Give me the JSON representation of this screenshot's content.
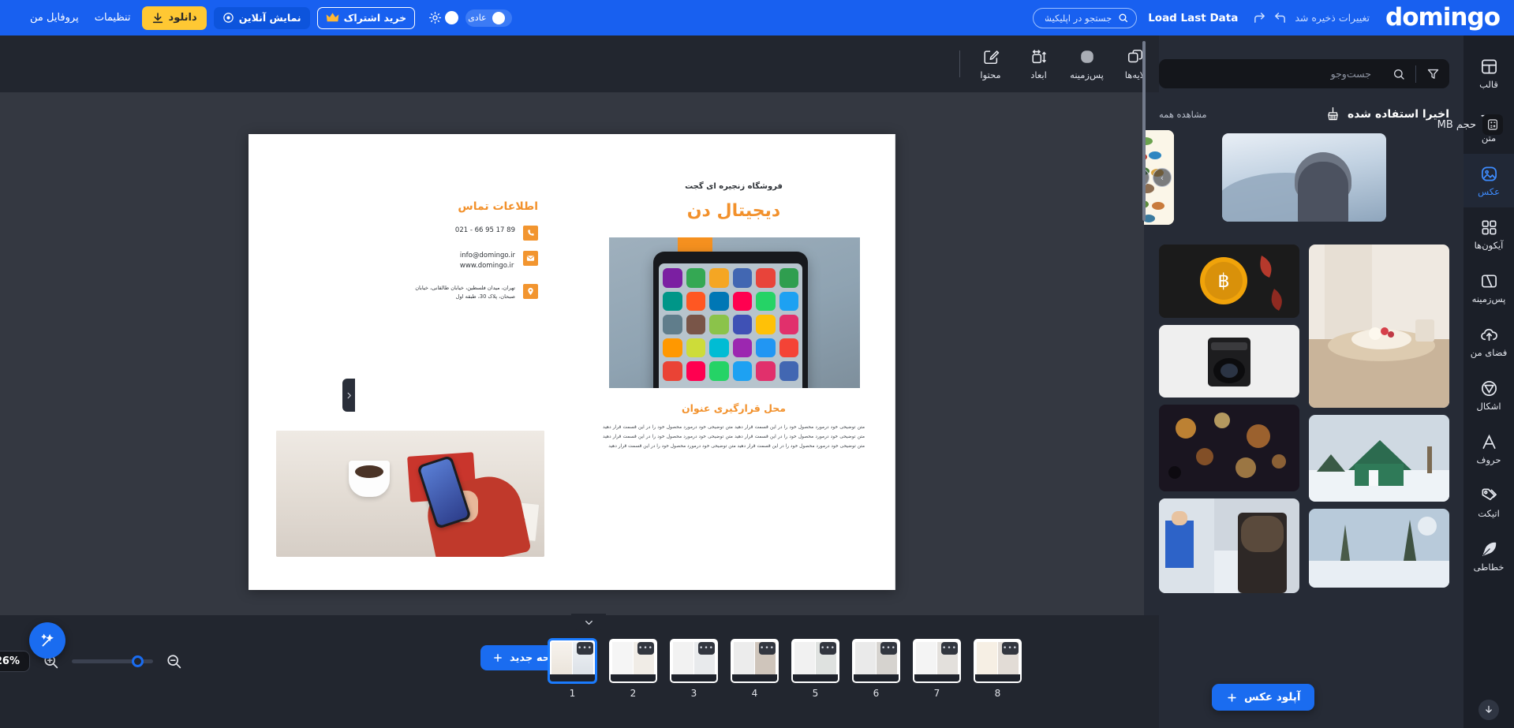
{
  "topbar": {
    "logo": "domingo",
    "saved_text": "تغییرات ذخیره شد",
    "undo_icon": "undo-icon",
    "redo_icon": "redo-icon",
    "load_last_data": "Load Last Data",
    "search_placeholder": "جستجو در اپلیکیشن...",
    "search_value": "",
    "mode_toggle_label": "عادی",
    "theme_icon": "sun-icon",
    "buy_subscription": "خرید اشتراک",
    "crown_icon": "crown-icon",
    "online_preview": "نمایش آنلاین",
    "eye_icon": "eye-icon",
    "download": "دانلود",
    "download_icon": "download-icon",
    "settings": "تنظیمات",
    "my_profile": "پروفایل من",
    "accent": "#1860f0",
    "download_color": "#ffc833"
  },
  "left_tools": [
    {
      "label": "لایه‌ها",
      "icon": "layers-icon"
    },
    {
      "label": "پس‌زمینه",
      "icon": "background-blob-icon"
    },
    {
      "label": "ابعاد",
      "icon": "dimensions-icon"
    },
    {
      "label": "محتوا",
      "icon": "edit-pencil-icon"
    }
  ],
  "canvas": {
    "size_badge": "حجم MB",
    "size_icon": "calculator-icon",
    "magic_icon": "magic-wand-icon",
    "collapse_icon": "chevron-down-icon",
    "panel_arrow_icon": "chevron-right-icon",
    "left_page": {
      "contact_heading": "اطلاعات تماس",
      "phone_icon": "phone-icon",
      "phone": "021 - 66 95 17 89",
      "mail_icon": "mail-icon",
      "email": "info@domingo.ir",
      "website": "www.domingo.ir",
      "pin_icon": "location-pin-icon",
      "address_line1": "تهران، میدان فلسطین، خیابان طالقانی، خیابان",
      "address_line2": "صبحان، پلاک 30، طبقه اول"
    },
    "right_page": {
      "subtitle": "فروشگاه زنجیره ای گجت",
      "title": "دیجیتال دن",
      "section_title": "محل قرارگیری عنوان",
      "body": "متن توضیحی خود درمورد محصول خود را در این قسمت قرار دهید  متن توضیحی خود درمورد محصول خود را در این قسمت قرار دهید  متن توضیحی خود درمورد محصول خود را در این قسمت قرار دهید  متن توضیحی خود درمورد محصول خود را در این قسمت قرار دهید  متن توضیحی خود درمورد محصول خود را در این قسمت قرار دهید  متن توضیحی خود درمورد محصول خود را در این قسمت قرار دهید"
    }
  },
  "bottombar": {
    "zoom_value": "26%",
    "zoom_chevron_icon": "chevron-down-icon",
    "zoom_in_icon": "zoom-in-icon",
    "zoom_out_icon": "zoom-out-icon",
    "new_page": "صفحه جدید",
    "plus_icon": "plus-icon",
    "thumb_menu_icon": "more-dots-icon",
    "pages": [
      "1",
      "2",
      "3",
      "4",
      "5",
      "6",
      "7",
      "8"
    ],
    "selected_page": "1"
  },
  "image_panel": {
    "search_placeholder": "جست‌وجو",
    "search_value": "",
    "search_icon": "search-icon",
    "filter_icon": "filter-icon",
    "section_title": "اخیرا استفاده شده",
    "section_icon": "broom-icon",
    "see_all": "مشاهده همه",
    "next_icon": "chevron-right-circle-icon",
    "prev_icon": "chevron-left-circle-icon",
    "upload_label": "آپلود عکس",
    "upload_plus_icon": "plus-icon"
  },
  "rail": {
    "items": [
      {
        "label": "قالب",
        "icon": "template-icon",
        "active": false
      },
      {
        "label": "متن",
        "icon": "text-Tt-icon",
        "active": false
      },
      {
        "label": "عکس",
        "icon": "image-icon",
        "active": true
      },
      {
        "label": "آیکون‌ها",
        "icon": "grid-squares-icon",
        "active": false
      },
      {
        "label": "پس‌زمینه",
        "icon": "background-icon",
        "active": false
      },
      {
        "label": "فضای من",
        "icon": "cloud-upload-icon",
        "active": false
      },
      {
        "label": "اشکال",
        "icon": "shapes-icon",
        "active": false
      },
      {
        "label": "حروف",
        "icon": "letter-a-icon",
        "active": false
      },
      {
        "label": "اتیکت",
        "icon": "tag-icon",
        "active": false
      },
      {
        "label": "خطاطی",
        "icon": "feather-icon",
        "active": false
      }
    ],
    "bottom_icon": "download-circle-icon",
    "active_color": "#3e8cff"
  }
}
